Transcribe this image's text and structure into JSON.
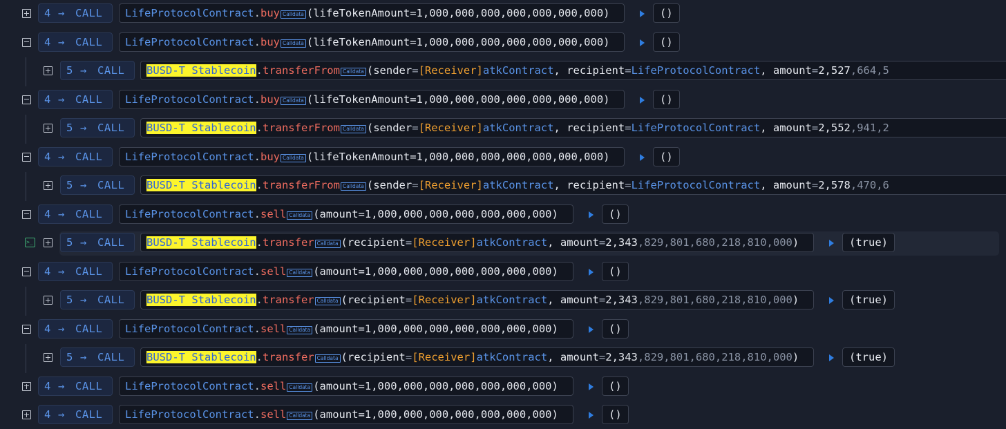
{
  "trace": {
    "rows": [
      {
        "toggle": "collapsed",
        "depth": "4",
        "arrow": "→",
        "op": "CALL",
        "contract": "LifeProtocolContract",
        "method": "buy",
        "calldata_label": "Calldata",
        "params": "(lifeTokenAmount=1,000,000,000,000,000,000,000)",
        "returns": "()"
      },
      {
        "toggle": "expanded",
        "depth": "4",
        "arrow": "→",
        "op": "CALL",
        "contract": "LifeProtocolContract",
        "method": "buy",
        "calldata_label": "Calldata",
        "params": "(lifeTokenAmount=1,000,000,000,000,000,000,000)",
        "returns": "()"
      },
      {
        "toggle": "collapsed",
        "depth": "5",
        "arrow": "→",
        "op": "CALL",
        "contract": "BUSD-T Stablecoin",
        "method": "transferFrom",
        "calldata_label": "Calldata",
        "sender_tag": "[Receiver]",
        "sender_name": "atkContract",
        "recipient": "LifeProtocolContract",
        "amount_bright": "2,527",
        "amount_dim": ",664,5"
      },
      {
        "toggle": "expanded",
        "depth": "4",
        "arrow": "→",
        "op": "CALL",
        "contract": "LifeProtocolContract",
        "method": "buy",
        "calldata_label": "Calldata",
        "params": "(lifeTokenAmount=1,000,000,000,000,000,000,000)",
        "returns": "()"
      },
      {
        "toggle": "collapsed",
        "depth": "5",
        "arrow": "→",
        "op": "CALL",
        "contract": "BUSD-T Stablecoin",
        "method": "transferFrom",
        "calldata_label": "Calldata",
        "sender_tag": "[Receiver]",
        "sender_name": "atkContract",
        "recipient": "LifeProtocolContract",
        "amount_bright": "2,552",
        "amount_dim": ",941,2"
      },
      {
        "toggle": "expanded",
        "depth": "4",
        "arrow": "→",
        "op": "CALL",
        "contract": "LifeProtocolContract",
        "method": "buy",
        "calldata_label": "Calldata",
        "params": "(lifeTokenAmount=1,000,000,000,000,000,000,000)",
        "returns": "()"
      },
      {
        "toggle": "collapsed",
        "depth": "5",
        "arrow": "→",
        "op": "CALL",
        "contract": "BUSD-T Stablecoin",
        "method": "transferFrom",
        "calldata_label": "Calldata",
        "sender_tag": "[Receiver]",
        "sender_name": "atkContract",
        "recipient": "LifeProtocolContract",
        "amount_bright": "2,578",
        "amount_dim": ",470,6"
      },
      {
        "toggle": "expanded",
        "depth": "4",
        "arrow": "→",
        "op": "CALL",
        "contract": "LifeProtocolContract",
        "method": "sell",
        "calldata_label": "Calldata",
        "params": "(amount=1,000,000,000,000,000,000,000)",
        "returns": "()"
      },
      {
        "toggle": "collapsed",
        "depth": "5",
        "arrow": "→",
        "op": "CALL",
        "contract": "BUSD-T Stablecoin",
        "method": "transfer",
        "calldata_label": "Calldata",
        "recipient_tag": "[Receiver]",
        "recipient_name": "atkContract",
        "amount_bright": "2,343",
        "amount_dim": ",829,801,680,218,810,000",
        "returns": "(true)",
        "highlighted": true,
        "console_icon": ">_"
      },
      {
        "toggle": "expanded",
        "depth": "4",
        "arrow": "→",
        "op": "CALL",
        "contract": "LifeProtocolContract",
        "method": "sell",
        "calldata_label": "Calldata",
        "params": "(amount=1,000,000,000,000,000,000,000)",
        "returns": "()"
      },
      {
        "toggle": "collapsed",
        "depth": "5",
        "arrow": "→",
        "op": "CALL",
        "contract": "BUSD-T Stablecoin",
        "method": "transfer",
        "calldata_label": "Calldata",
        "recipient_tag": "[Receiver]",
        "recipient_name": "atkContract",
        "amount_bright": "2,343",
        "amount_dim": ",829,801,680,218,810,000",
        "returns": "(true)"
      },
      {
        "toggle": "expanded",
        "depth": "4",
        "arrow": "→",
        "op": "CALL",
        "contract": "LifeProtocolContract",
        "method": "sell",
        "calldata_label": "Calldata",
        "params": "(amount=1,000,000,000,000,000,000,000)",
        "returns": "()"
      },
      {
        "toggle": "collapsed",
        "depth": "5",
        "arrow": "→",
        "op": "CALL",
        "contract": "BUSD-T Stablecoin",
        "method": "transfer",
        "calldata_label": "Calldata",
        "recipient_tag": "[Receiver]",
        "recipient_name": "atkContract",
        "amount_bright": "2,343",
        "amount_dim": ",829,801,680,218,810,000",
        "returns": "(true)"
      },
      {
        "toggle": "collapsed",
        "depth": "4",
        "arrow": "→",
        "op": "CALL",
        "contract": "LifeProtocolContract",
        "method": "sell",
        "calldata_label": "Calldata",
        "params": "(amount=1,000,000,000,000,000,000,000)",
        "returns": "()"
      },
      {
        "toggle": "collapsed",
        "depth": "4",
        "arrow": "→",
        "op": "CALL",
        "contract": "LifeProtocolContract",
        "method": "sell",
        "calldata_label": "Calldata",
        "params": "(amount=1,000,000,000,000,000,000,000)",
        "returns": "()"
      }
    ]
  },
  "colors": {
    "background": "#1a1f2c",
    "contract": "#5a94e8",
    "method": "#ee6c5f",
    "token_highlight": "#fcf52c",
    "receiver_tag": "#f0a030",
    "caret": "#2f7de0",
    "console_icon": "#3fae74"
  },
  "icons": {
    "expand": "plus-square-icon",
    "collapse": "minus-square-icon",
    "arrow": "right-arrow-icon",
    "expand_return": "caret-right-icon",
    "console": "console-icon",
    "calldata": "calldata-badge-icon"
  },
  "params_labels": {
    "sender": "sender",
    "recipient": "recipient",
    "amount": "amount"
  }
}
